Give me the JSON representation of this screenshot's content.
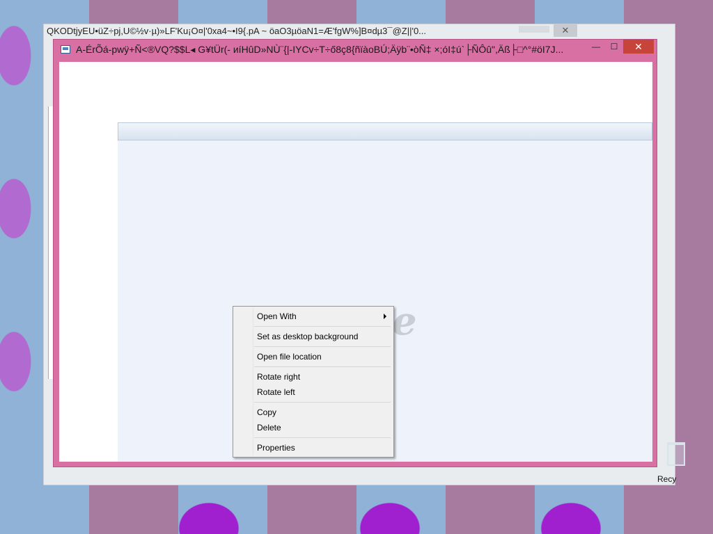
{
  "background_window": {
    "title": "QKODtjyEU•üZ÷pj,U©½v·µ)»LF'Ku¡O¤|'0xa4~•I9{.pA ~ öaO3µöaN1=Æ'fgW%]B¤dµ3¯@Z||'0...",
    "close_glyph": "✕"
  },
  "window": {
    "title": "A-ÉrÕá-pwÿ+Ñ<®VQ?$$L◂ G¥tÜr(- ᴎíHûD»NÙ¨{|-IYCv÷T÷ő8ç8{ñïàoBÚ;Äÿb¨•òÑ‡ ×;óI‡ú`├ÑÔû\",Äß├□^°#öI7J...",
    "minimize_glyph": "—",
    "maximize_glyph": "☐",
    "close_glyph": "✕"
  },
  "context_menu": {
    "items": [
      {
        "label": "Open With",
        "has_submenu": true
      },
      {
        "label": "Set as desktop background"
      },
      {
        "label": "Open file location"
      },
      {
        "label": "Rotate right"
      },
      {
        "label": "Rotate left"
      },
      {
        "label": "Copy"
      },
      {
        "label": "Delete"
      },
      {
        "label": "Properties"
      }
    ]
  },
  "desktop": {
    "recycle_bin_label": "Recy"
  },
  "icons": {
    "app_icon": "image-viewer-icon",
    "watermark": "internet-explorer-logo-icon",
    "recycle": "recycle-bin-icon",
    "submenu": "chevron-right-icon"
  },
  "colors": {
    "window_frame": "#d870a4",
    "close_button": "#c7443a",
    "viewer_background": "#eef2fa",
    "menu_background": "#f0f0f0"
  }
}
